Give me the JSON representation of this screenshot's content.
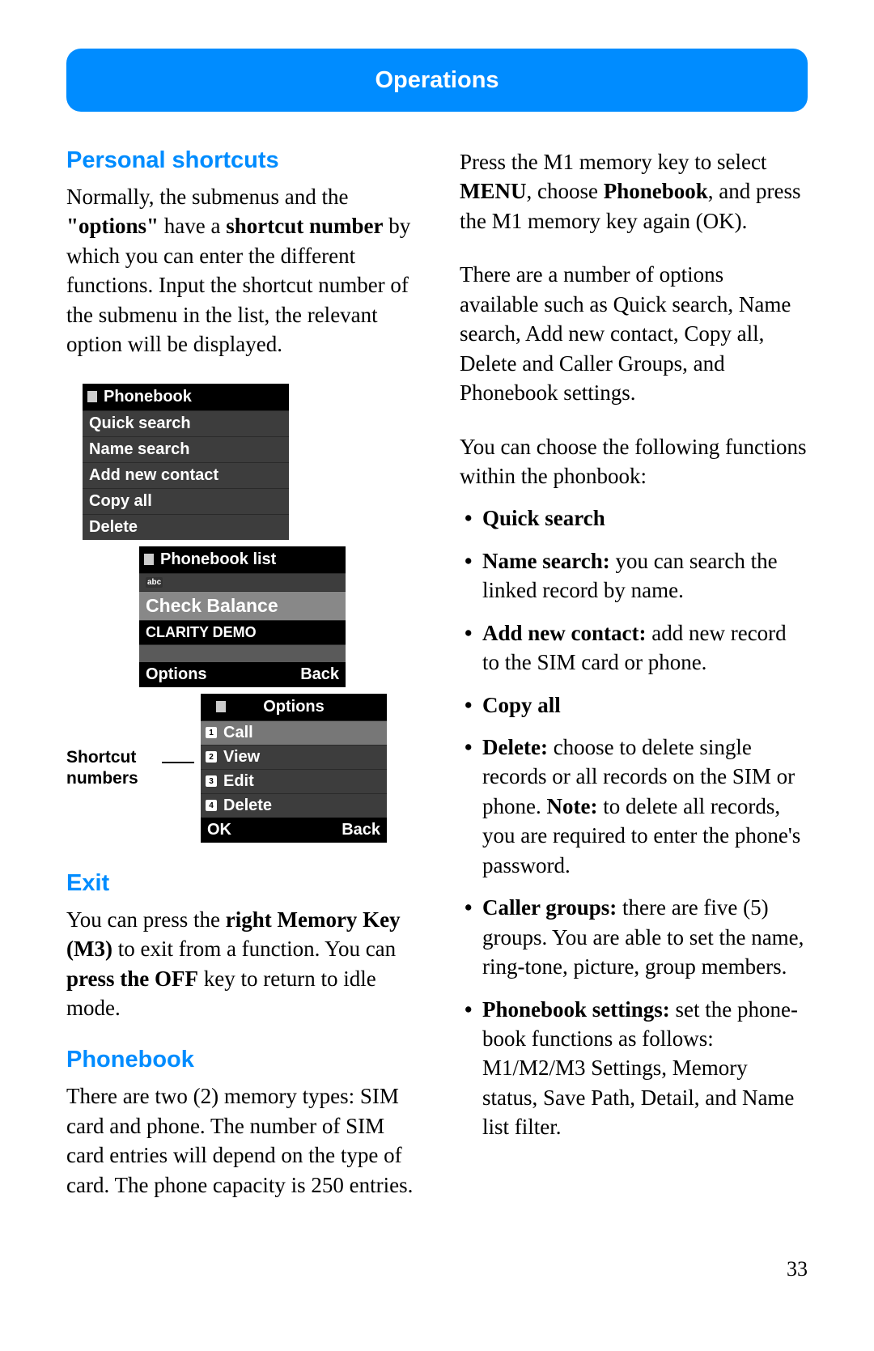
{
  "header": {
    "title": "Operations"
  },
  "page_number": "33",
  "left": {
    "personal_shortcuts": {
      "heading": "Personal shortcuts",
      "para_pre": "Normally, the submenus and the ",
      "para_b1": "\"options\"",
      "para_mid1": " have a ",
      "para_b2": "shortcut number",
      "para_post": " by which you can enter the different functions. Input the shortcut number of the submenu in the list, the relevant option will be displayed."
    },
    "screen1": {
      "title": "Phonebook",
      "items": [
        "Quick search",
        "Name search",
        "Add new contact",
        "Copy all",
        "Delete"
      ]
    },
    "screen2": {
      "title": "Phonebook list",
      "selected": "Check Balance",
      "second": "CLARITY DEMO",
      "soft_left": "Options",
      "soft_right": "Back"
    },
    "screen3": {
      "title": "Options",
      "items": [
        {
          "n": "1",
          "label": "Call"
        },
        {
          "n": "2",
          "label": "View"
        },
        {
          "n": "3",
          "label": "Edit"
        },
        {
          "n": "4",
          "label": "Delete"
        }
      ],
      "soft_left": "OK",
      "soft_right": "Back"
    },
    "shortcut_label_line1": "Shortcut",
    "shortcut_label_line2": "numbers",
    "exit": {
      "heading": "Exit",
      "p1_a": "You can press the ",
      "p1_b": "right Memory Key (M3)",
      "p1_c": " to exit from a function.  You can ",
      "p1_d": "press the OFF",
      "p1_e": " key to return to idle mode."
    },
    "phonebook": {
      "heading": "Phonebook",
      "p": "There are two (2) memory types: SIM card and phone.  The number of SIM card entries will depend on the type of card.  The phone capacity is 250 entries."
    }
  },
  "right": {
    "p1_a": "Press the M1 memory key to select ",
    "p1_b": "MENU",
    "p1_c": ", choose ",
    "p1_d": "Phonebook",
    "p1_e": ", and press the M1 memory key again (OK).",
    "p2": "There are a number of options available such as Quick search, Name search, Add new contact, Copy all, Delete and Caller Groups, and Phonebook settings.",
    "p3": "You can choose the following functions within the phonbook:",
    "bullets": {
      "quick": "Quick search",
      "name_b": "Name search:",
      "name_t": " you can search the linked record by name.",
      "add_b": "Add new contact:",
      "add_t": " add new record to the SIM card or phone.",
      "copy": "Copy all",
      "del_b": "Delete:",
      "del_t1": " choose to delete single records or all records on the SIM or phone. ",
      "del_note_b": "Note:",
      "del_t2": " to delete all records, you are required to enter the phone's password.",
      "cg_b": "Caller groups:",
      "cg_t": " there are five (5) groups. You are able to set the name, ring-tone, picture, group members.",
      "pb_b": "Phonebook settings:",
      "pb_t": " set the phone-book functions as follows: M1/M2/M3 Settings, Memory status, Save Path, Detail, and Name list filter."
    }
  }
}
